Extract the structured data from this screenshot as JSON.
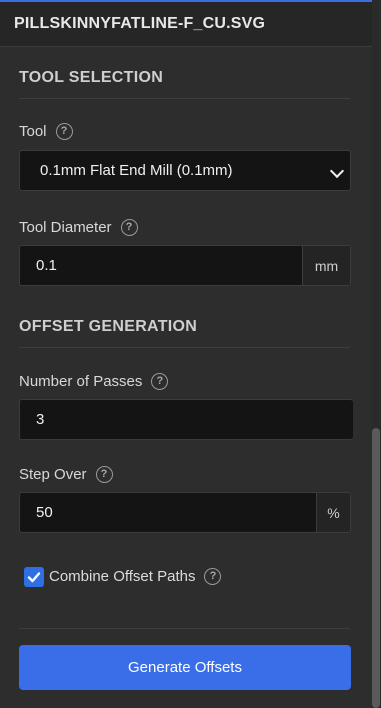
{
  "header": {
    "title": "PILLSKINNYFATLINE-F_CU.SVG"
  },
  "tool_selection": {
    "section_title": "TOOL SELECTION",
    "tool_label": "Tool",
    "tool_value": "0.1mm Flat End Mill (0.1mm)",
    "diameter_label": "Tool Diameter",
    "diameter_value": "0.1",
    "diameter_unit": "mm"
  },
  "offset_generation": {
    "section_title": "OFFSET GENERATION",
    "passes_label": "Number of Passes",
    "passes_value": "3",
    "stepover_label": "Step Over",
    "stepover_value": "50",
    "stepover_unit": "%",
    "combine_label": "Combine Offset Paths",
    "combine_checked": true
  },
  "actions": {
    "generate_label": "Generate Offsets"
  },
  "icons": {
    "help": "help-circle-icon",
    "dropdown": "chevron-down-icon",
    "check": "check-icon"
  },
  "colors": {
    "accent": "#3a6ee8",
    "background": "#2d2d2d",
    "input_bg": "#141414"
  }
}
